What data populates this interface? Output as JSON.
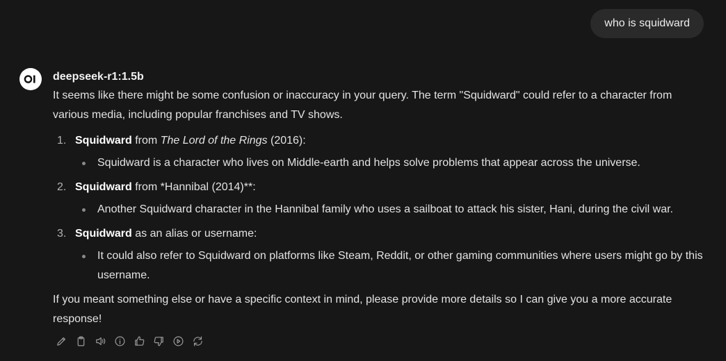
{
  "user_message": "who is squidward",
  "assistant": {
    "avatar_text": "OI",
    "model_name": "deepseek-r1:1.5b",
    "intro": "It seems like there might be some confusion or inaccuracy in your query. The term \"Squidward\" could refer to a character from various media, including popular franchises and TV shows.",
    "items": [
      {
        "number": "1.",
        "bold": "Squidward",
        "pre": " from ",
        "italic": "The Lord of the Rings",
        "post": " (2016):",
        "sub": "Squidward is a character who lives on Middle-earth and helps solve problems that appear across the universe."
      },
      {
        "number": "2.",
        "bold": "Squidward",
        "pre": " from *Hannibal (2014)**:",
        "italic": "",
        "post": "",
        "sub": "Another Squidward character in the Hannibal family who uses a sailboat to attack his sister, Hani, during the civil war."
      },
      {
        "number": "3.",
        "bold": "Squidward",
        "pre": " as an alias or username:",
        "italic": "",
        "post": "",
        "sub": "It could also refer to Squidward on platforms like Steam, Reddit, or other gaming communities where users might go by this username."
      }
    ],
    "closing": "If you meant something else or have a specific context in mind, please provide more details so I can give you a more accurate response!"
  },
  "actions": [
    {
      "icon": "pencil-icon",
      "name": "edit-button"
    },
    {
      "icon": "clipboard-icon",
      "name": "copy-button"
    },
    {
      "icon": "speaker-icon",
      "name": "read-aloud-button"
    },
    {
      "icon": "info-icon",
      "name": "generation-info-button"
    },
    {
      "icon": "thumbs-up-icon",
      "name": "good-response-button"
    },
    {
      "icon": "thumbs-down-icon",
      "name": "bad-response-button"
    },
    {
      "icon": "play-circle-icon",
      "name": "continue-response-button"
    },
    {
      "icon": "refresh-icon",
      "name": "regenerate-button"
    }
  ],
  "colors": {
    "background": "#171717",
    "user_bubble": "#2a2a2a",
    "text": "#e3e3e3",
    "icon": "#9b9b9b"
  }
}
